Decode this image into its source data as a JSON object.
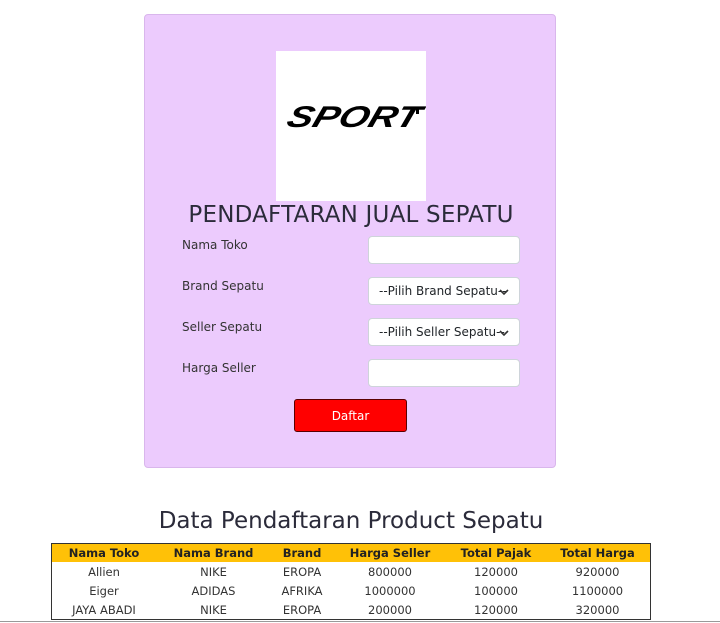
{
  "logo": {
    "text": "SPORT"
  },
  "form": {
    "title": "PENDAFTARAN JUAL SEPATU",
    "nama_toko_label": "Nama Toko",
    "nama_toko_value": "",
    "brand_label": "Brand Sepatu",
    "brand_selected": "--Pilih Brand Sepatu--",
    "seller_label": "Seller Sepatu",
    "seller_selected": "--Pilih Seller Sepatu--",
    "harga_label": "Harga Seller",
    "harga_value": "",
    "submit_label": "Daftar"
  },
  "table": {
    "title": "Data Pendaftaran Product Sepatu",
    "headers": [
      "Nama Toko",
      "Nama Brand",
      "Brand",
      "Harga Seller",
      "Total Pajak",
      "Total Harga"
    ],
    "rows": [
      [
        "Allien",
        "NIKE",
        "EROPA",
        "800000",
        "120000",
        "920000"
      ],
      [
        "Eiger",
        "ADIDAS",
        "AFRIKA",
        "1000000",
        "100000",
        "1100000"
      ],
      [
        "JAYA ABADI",
        "NIKE",
        "EROPA",
        "200000",
        "120000",
        "320000"
      ]
    ]
  },
  "colors": {
    "card_bg": "#eccbfd",
    "button_bg": "#ff0000",
    "table_header_bg": "#ffc107"
  }
}
